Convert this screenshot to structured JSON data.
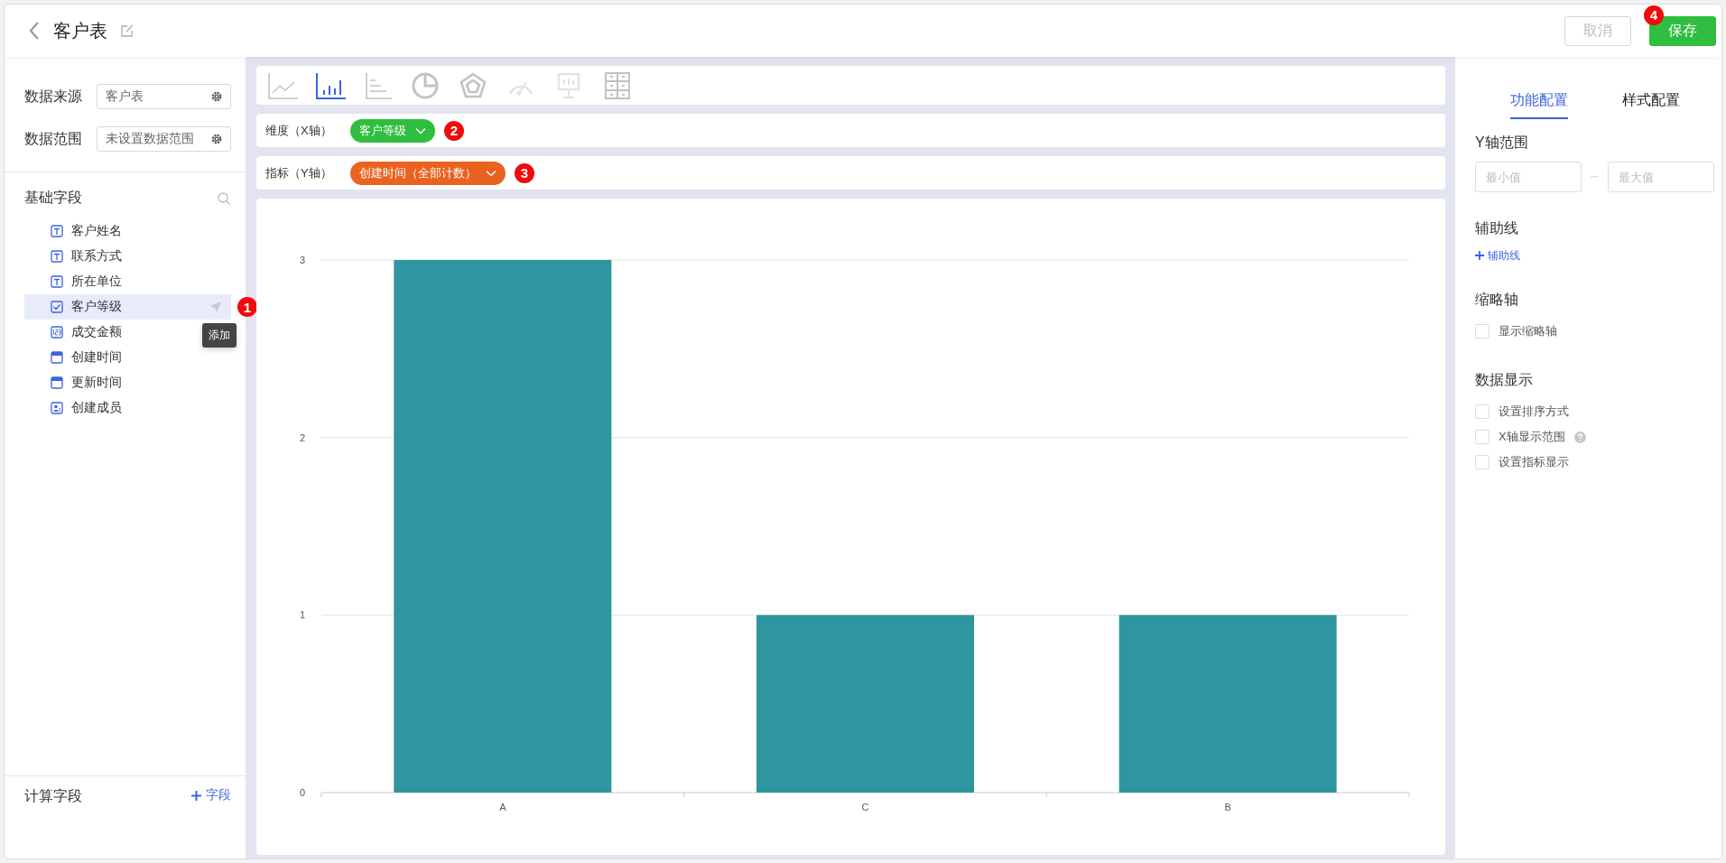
{
  "header": {
    "title": "客户表",
    "buttons": [
      {
        "label": "取消",
        "kind": "secondary",
        "disabled": true
      },
      {
        "label": "保存",
        "kind": "primary",
        "disabled": false,
        "marker": "4"
      }
    ]
  },
  "left": {
    "source": {
      "label": "数据来源",
      "value": "客户表"
    },
    "range": {
      "label": "数据范围",
      "value": "未设置数据范围"
    },
    "fields_title": "基础字段",
    "fields": [
      {
        "kind": "text",
        "label": "客户姓名",
        "selected": false
      },
      {
        "kind": "text",
        "label": "联系方式",
        "selected": false
      },
      {
        "kind": "text",
        "label": "所在单位",
        "selected": false
      },
      {
        "kind": "option",
        "label": "客户等级",
        "selected": true,
        "tooltip": "添加",
        "marker": "1"
      },
      {
        "kind": "number",
        "label": "成交金额",
        "selected": false
      },
      {
        "kind": "date",
        "label": "创建时间",
        "selected": false
      },
      {
        "kind": "date",
        "label": "更新时间",
        "selected": false
      },
      {
        "kind": "member",
        "label": "创建成员",
        "selected": false
      }
    ],
    "calc": {
      "title": "计算字段",
      "action": "字段"
    }
  },
  "chart_types": [
    {
      "kind": "line",
      "selected": false,
      "disabled": false
    },
    {
      "kind": "bar",
      "selected": true,
      "disabled": false
    },
    {
      "kind": "hbar",
      "selected": false,
      "disabled": false
    },
    {
      "kind": "pie",
      "selected": false,
      "disabled": false
    },
    {
      "kind": "radar",
      "selected": false,
      "disabled": false
    },
    {
      "kind": "gauge",
      "selected": false,
      "disabled": true
    },
    {
      "kind": "board",
      "selected": false,
      "disabled": true
    },
    {
      "kind": "table",
      "selected": false,
      "disabled": false
    }
  ],
  "axes": [
    {
      "label": "维度（X轴）",
      "field": "客户等级",
      "color": "#2fbe3f",
      "marker": "2"
    },
    {
      "label": "指标（Y轴）",
      "field": "创建时间（全部计数）",
      "color": "#e9621f",
      "marker": "3"
    }
  ],
  "chart_data": {
    "type": "bar",
    "categories": [
      "A",
      "C",
      "B"
    ],
    "series": [
      {
        "color": "#2e969e",
        "values": [
          3,
          1,
          1
        ]
      }
    ],
    "ylim": [
      0,
      3
    ],
    "yticks": [
      0,
      1,
      2,
      3
    ]
  },
  "right": {
    "tabs": [
      {
        "label": "功能配置",
        "selected": true
      },
      {
        "label": "样式配置",
        "selected": false
      }
    ],
    "sections": [
      {
        "kind": "range",
        "title": "Y轴范围",
        "min_placeholder": "最小值",
        "max_placeholder": "最大值"
      },
      {
        "kind": "add",
        "title": "辅助线",
        "action": "辅助线"
      },
      {
        "kind": "checks",
        "title": "缩略轴",
        "options": [
          {
            "label": "显示缩略轴",
            "checked": false,
            "help": false
          }
        ]
      },
      {
        "kind": "checks",
        "title": "数据显示",
        "options": [
          {
            "label": "设置排序方式",
            "checked": false,
            "help": false
          },
          {
            "label": "X轴显示范围",
            "checked": false,
            "help": true
          },
          {
            "label": "设置指标显示",
            "checked": false,
            "help": false
          }
        ]
      }
    ]
  }
}
